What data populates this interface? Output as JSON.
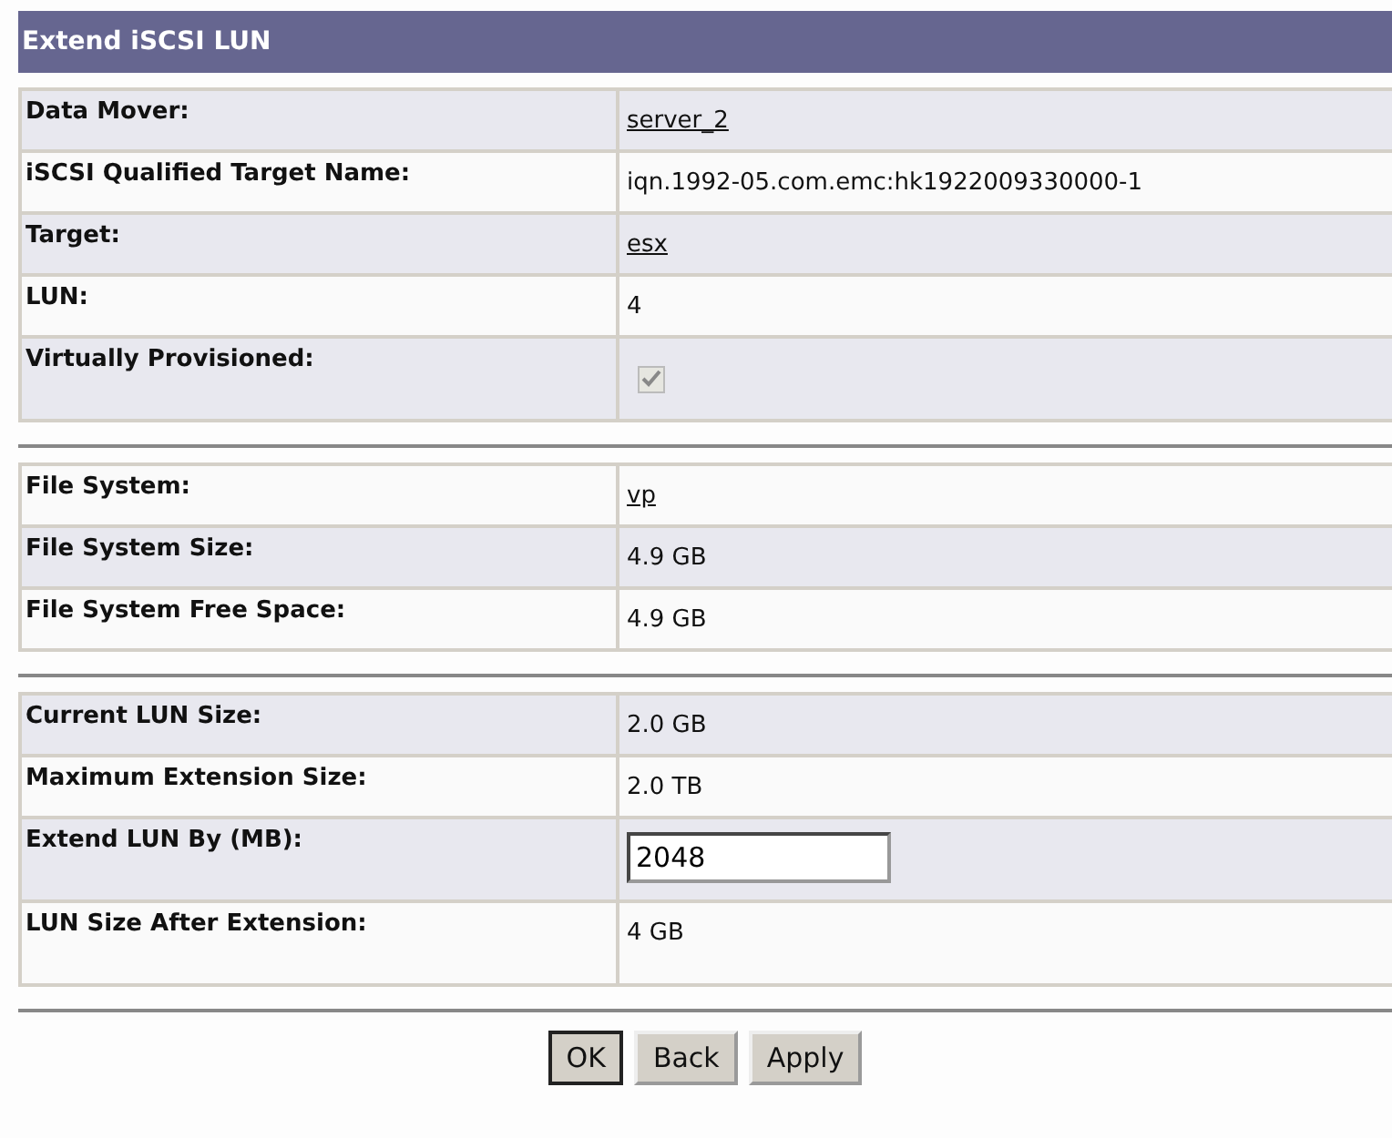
{
  "title": "Extend iSCSI LUN",
  "sections": [
    {
      "rows": [
        {
          "label": "Data Mover:",
          "kind": "link",
          "value": "server_2"
        },
        {
          "label": "iSCSI Qualified Target Name:",
          "kind": "text",
          "value": "iqn.1992-05.com.emc:hk1922009330000-1"
        },
        {
          "label": "Target:",
          "kind": "link",
          "value": "esx"
        },
        {
          "label": "LUN:",
          "kind": "text",
          "value": "4"
        },
        {
          "label": "Virtually Provisioned:",
          "kind": "checkbox",
          "checked": true,
          "disabled": true
        }
      ]
    },
    {
      "rows": [
        {
          "label": "File System:",
          "kind": "link",
          "value": "vp"
        },
        {
          "label": "File System Size:",
          "kind": "text",
          "value": "4.9 GB"
        },
        {
          "label": "File System Free Space:",
          "kind": "text",
          "value": "4.9 GB"
        }
      ]
    },
    {
      "rows": [
        {
          "label": "Current LUN Size:",
          "kind": "text",
          "value": "2.0 GB"
        },
        {
          "label": "Maximum Extension Size:",
          "kind": "text",
          "value": "2.0 TB"
        },
        {
          "label": "Extend LUN By (MB):",
          "kind": "input",
          "value": "2048"
        },
        {
          "label": "LUN Size After Extension:",
          "kind": "text",
          "value": "4 GB"
        }
      ]
    }
  ],
  "buttons": [
    {
      "label": "OK",
      "focused": true
    },
    {
      "label": "Back",
      "focused": false
    },
    {
      "label": "Apply",
      "focused": false
    }
  ]
}
